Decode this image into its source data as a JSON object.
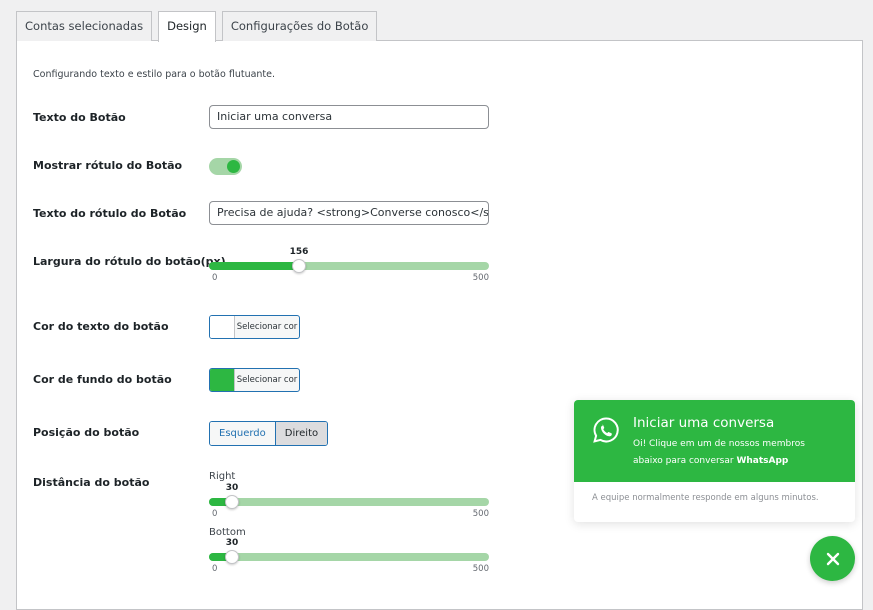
{
  "tabs": [
    {
      "label": "Contas selecionadas",
      "active": false
    },
    {
      "label": "Design",
      "active": true
    },
    {
      "label": "Configurações do Botão",
      "active": false
    }
  ],
  "intro": "Configurando texto e estilo para o botão flutuante.",
  "fields": {
    "button_text": {
      "label": "Texto do Botão",
      "value": "Iniciar uma conversa"
    },
    "show_label": {
      "label": "Mostrar rótulo do Botão",
      "enabled": true
    },
    "label_text": {
      "label": "Texto do rótulo do Botão",
      "value": "Precisa de ajuda? <strong>Converse conosco</strong>"
    },
    "label_width": {
      "label": "Largura do rótulo do botão(px)",
      "value": 156,
      "min": 0,
      "max": 500,
      "value_text": "156",
      "min_text": "0",
      "max_text": "500"
    },
    "text_color": {
      "label": "Cor do texto do botão",
      "color": "#ffffff",
      "button_text": "Selecionar cor"
    },
    "bg_color": {
      "label": "Cor de fundo do botão",
      "color": "#2db742",
      "button_text": "Selecionar cor"
    },
    "position": {
      "label": "Posição do botão",
      "options": [
        "Esquerdo",
        "Direito"
      ],
      "selected": "Direito"
    },
    "distance": {
      "label": "Distância do botão",
      "right": {
        "label": "Right",
        "value": 30,
        "min": 0,
        "max": 500,
        "value_text": "30",
        "min_text": "0",
        "max_text": "500"
      },
      "bottom": {
        "label": "Bottom",
        "value": 30,
        "min": 0,
        "max": 500,
        "value_text": "30",
        "min_text": "0",
        "max_text": "500"
      }
    }
  },
  "preview": {
    "title": "Iniciar uma conversa",
    "message": "Oi! Clique em um de nossos membros abaixo para conversar ",
    "message_bold": "WhatsApp",
    "note": "A equipe normalmente responde em alguns minutos.",
    "icon": "whatsapp-icon",
    "close_icon": "close-icon"
  },
  "colors": {
    "accent": "#2db742",
    "accent_light": "#a5d6a7",
    "link": "#2271b1"
  }
}
